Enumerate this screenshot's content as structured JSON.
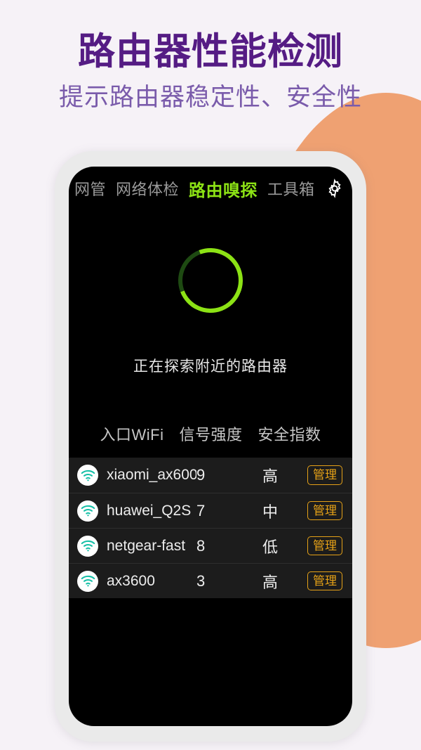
{
  "promo": {
    "title": "路由器性能检测",
    "subtitle": "提示路由器稳定性、安全性",
    "title_color": "#551C84",
    "subtitle_color": "#7A5BAB",
    "background_color": "#F6F2F7",
    "accent_blob_color": "#EFA172"
  },
  "app": {
    "accent_green": "#8CE215",
    "screen_background": "#000000",
    "list_background": "#1C1C1C",
    "manage_color": "#E5A117",
    "wifi_icon_color": "#13BFA6",
    "tabs": [
      {
        "label": "网管",
        "active": false
      },
      {
        "label": "网络体检",
        "active": false
      },
      {
        "label": "路由嗅探",
        "active": true
      },
      {
        "label": "工具箱",
        "active": false
      }
    ],
    "settings_icon": "gear-icon",
    "scan": {
      "status_text": "正在探索附近的路由器",
      "spinner_icon": "loading-spinner-icon",
      "progress_percent": 75
    },
    "table": {
      "headers": [
        "入口WiFi",
        "信号强度",
        "安全指数"
      ],
      "action_label": "管理",
      "rows": [
        {
          "icon": "wifi-icon",
          "ssid": "xiaomi_ax600",
          "signal": "9",
          "security": "高",
          "action": "管理"
        },
        {
          "icon": "wifi-icon",
          "ssid": "huawei_Q2S",
          "signal": "7",
          "security": "中",
          "action": "管理"
        },
        {
          "icon": "wifi-icon",
          "ssid": "netgear-fast",
          "signal": "8",
          "security": "低",
          "action": "管理"
        },
        {
          "icon": "wifi-icon",
          "ssid": "ax3600",
          "signal": "3",
          "security": "高",
          "action": "管理"
        }
      ]
    }
  }
}
